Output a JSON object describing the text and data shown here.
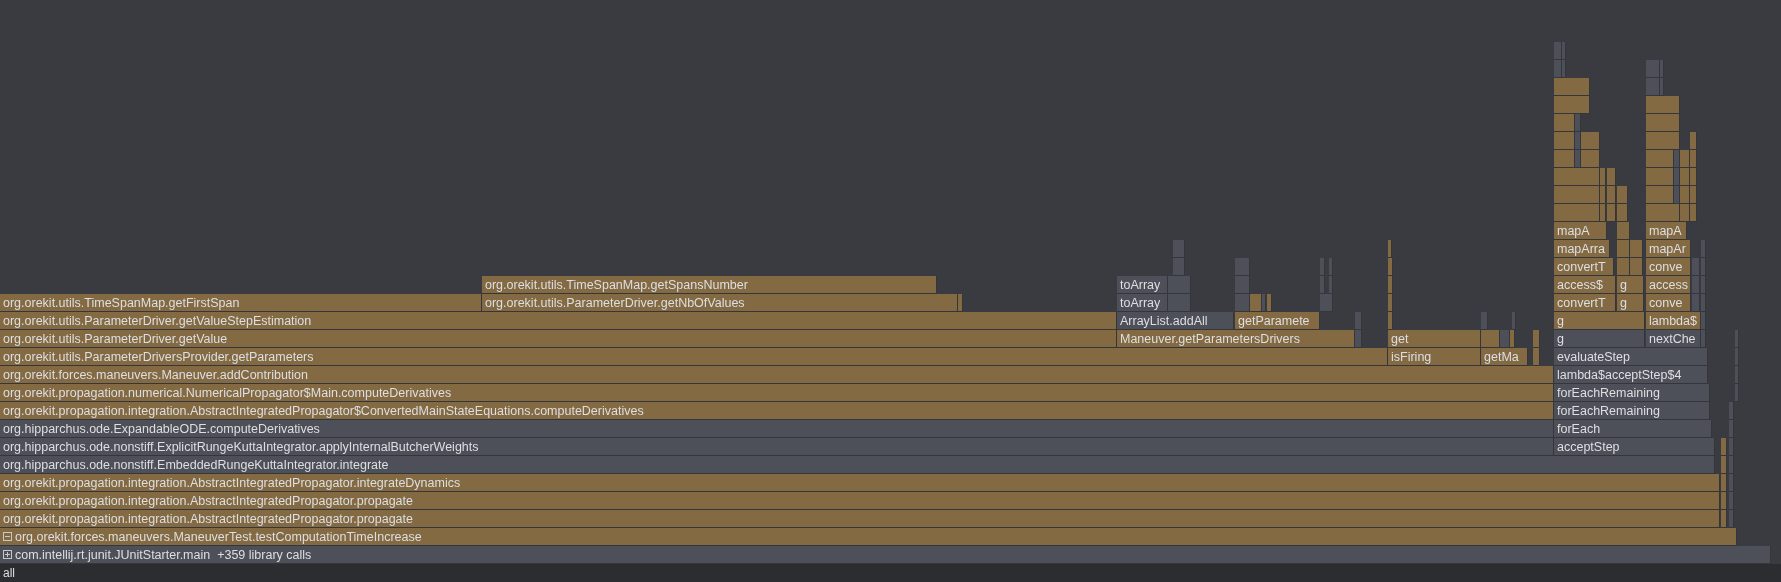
{
  "frames": [
    {
      "label": "mapA",
      "color": "#836a42"
    },
    {
      "label": "mapA",
      "color": "#836a42"
    },
    {
      "label": "mapArra",
      "color": "#836a42"
    },
    {
      "label": "mapAr",
      "color": "#836a42"
    },
    {
      "label": "convertT",
      "color": "#836a42"
    },
    {
      "label": "conve",
      "color": "#836a42"
    },
    {
      "label": "org.orekit.utils.TimeSpanMap.getSpansNumber",
      "color": "#836a42"
    },
    {
      "label": "toArray",
      "color": "#4e5059"
    },
    {
      "label": "access$",
      "color": "#836a42"
    },
    {
      "label": "g",
      "color": "#836a42"
    },
    {
      "label": "access",
      "color": "#836a42"
    },
    {
      "label": "org.orekit.utils.TimeSpanMap.getFirstSpan",
      "color": "#836a42"
    },
    {
      "label": "org.orekit.utils.ParameterDriver.getNbOfValues",
      "color": "#836a42"
    },
    {
      "label": "toArray",
      "color": "#4e5059"
    },
    {
      "label": "convertT",
      "color": "#836a42"
    },
    {
      "label": "g",
      "color": "#836a42"
    },
    {
      "label": "conve",
      "color": "#836a42"
    },
    {
      "label": "org.orekit.utils.ParameterDriver.getValueStepEstimation",
      "color": "#836a42"
    },
    {
      "label": "ArrayList.addAll",
      "color": "#4e5059"
    },
    {
      "label": "getParamete",
      "color": "#836a42"
    },
    {
      "label": "g",
      "color": "#836a42"
    },
    {
      "label": "lambda$",
      "color": "#836a42"
    },
    {
      "label": "org.orekit.utils.ParameterDriver.getValue",
      "color": "#836a42"
    },
    {
      "label": "Maneuver.getParametersDrivers",
      "color": "#836a42"
    },
    {
      "label": "get",
      "color": "#836a42"
    },
    {
      "label": "g",
      "color": "#4e5059"
    },
    {
      "label": "nextChe",
      "color": "#4e5059"
    },
    {
      "label": "org.orekit.utils.ParameterDriversProvider.getParameters",
      "color": "#836a42"
    },
    {
      "label": "isFiring",
      "color": "#836a42"
    },
    {
      "label": "getMa",
      "color": "#836a42"
    },
    {
      "label": "evaluateStep",
      "color": "#4e5059"
    },
    {
      "label": "org.orekit.forces.maneuvers.Maneuver.addContribution",
      "color": "#836a42"
    },
    {
      "label": "lambda$acceptStep$4",
      "color": "#4e5059"
    },
    {
      "label": "org.orekit.propagation.numerical.NumericalPropagator$Main.computeDerivatives",
      "color": "#836a42"
    },
    {
      "label": "forEachRemaining",
      "color": "#4e5059"
    },
    {
      "label": "org.orekit.propagation.integration.AbstractIntegratedPropagator$ConvertedMainStateEquations.computeDerivatives",
      "color": "#836a42"
    },
    {
      "label": "forEachRemaining",
      "color": "#4e5059"
    },
    {
      "label": "org.hipparchus.ode.ExpandableODE.computeDerivatives",
      "color": "#4e5059"
    },
    {
      "label": "forEach",
      "color": "#4e5059"
    },
    {
      "label": "org.hipparchus.ode.nonstiff.ExplicitRungeKuttaIntegrator.applyInternalButcherWeights",
      "color": "#4e5059"
    },
    {
      "label": "acceptStep",
      "color": "#4e5059"
    },
    {
      "label": "org.hipparchus.ode.nonstiff.EmbeddedRungeKuttaIntegrator.integrate",
      "color": "#4e5059"
    },
    {
      "label": "org.orekit.propagation.integration.AbstractIntegratedPropagator.integrateDynamics",
      "color": "#836a42"
    },
    {
      "label": "org.orekit.propagation.integration.AbstractIntegratedPropagator.propagate",
      "color": "#836a42"
    },
    {
      "label": "org.orekit.propagation.integration.AbstractIntegratedPropagator.propagate",
      "color": "#836a42"
    },
    {
      "label": "org.orekit.forces.maneuvers.ManeuverTest.testComputationTimeIncrease",
      "color": "#836a42",
      "expanded": true
    },
    {
      "label": "com.intellij.rt.junit.JUnitStarter.main  +359 library calls",
      "color": "#4e5059",
      "expanded": false
    }
  ],
  "status_bar": {
    "text": "all"
  }
}
